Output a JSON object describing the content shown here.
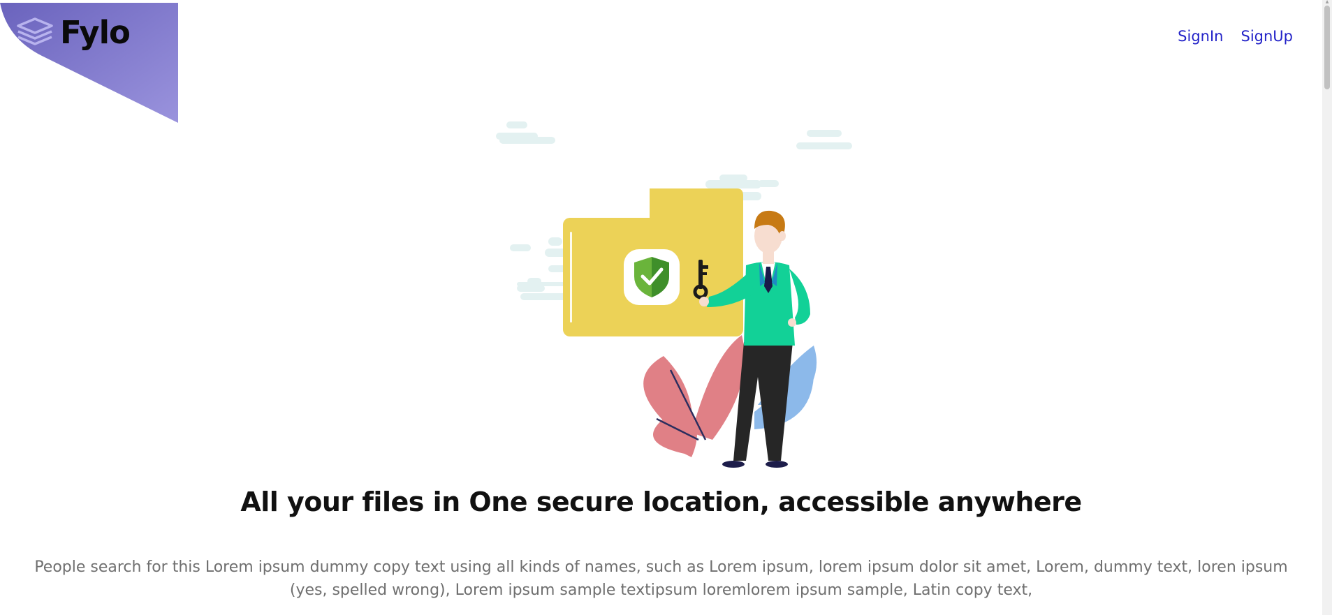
{
  "brand": {
    "name": "Fylo",
    "accent_color": "#7a72c8",
    "logo_icon": "stacked-layers-icon"
  },
  "nav": {
    "signin_label": "SignIn",
    "signup_label": "SignUp",
    "link_color": "#2323c8"
  },
  "hero": {
    "illustration_icon": "secure-folder-illustration",
    "headline": "All your files in One secure location, accessible anywhere",
    "description": "People search for this Lorem ipsum dummy copy text using all kinds of names, such as Lorem ipsum, lorem ipsum dolor sit amet, Lorem, dummy text, loren ipsum (yes, spelled wrong), Lorem ipsum sample textipsum loremlorem ipsum sample, Latin copy text,"
  }
}
